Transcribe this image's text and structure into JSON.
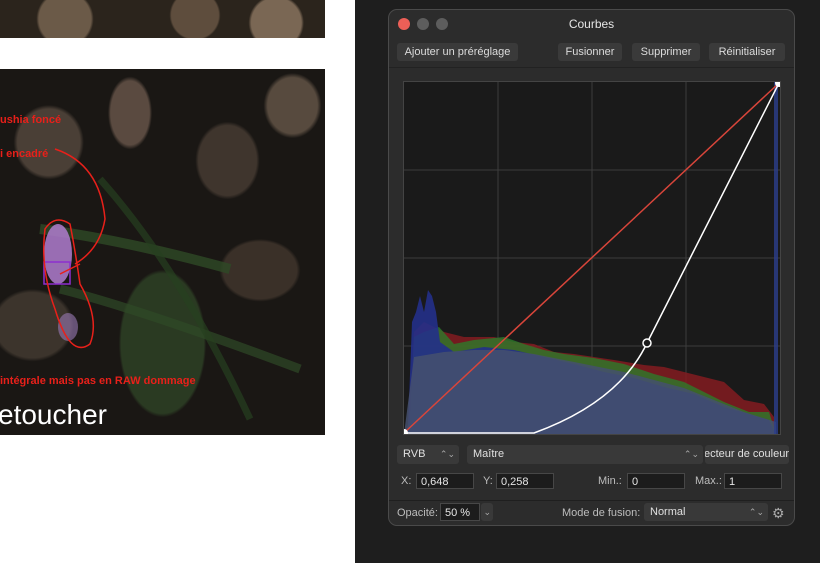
{
  "left": {
    "annotations": [
      "ushia foncé",
      "i encadré",
      "intégrale mais pas en RAW dommage"
    ],
    "heading": "etoucher"
  },
  "panel": {
    "title": "Courbes",
    "buttons": {
      "preset": "Ajouter un préréglage",
      "merge": "Fusionner",
      "delete": "Supprimer",
      "reset": "Réinitialiser"
    },
    "channel": "RVB",
    "mode_select": "Maître",
    "color_picker": "Sélecteur de couleur",
    "x_label": "X:",
    "x_value": "0,648",
    "y_label": "Y:",
    "y_value": "0,258",
    "min_label": "Min.:",
    "min_value": "0",
    "max_label": "Max.:",
    "max_value": "1",
    "opacity_label": "Opacité:",
    "opacity_value": "50 %",
    "blend_label": "Mode de fusion:",
    "blend_value": "Normal",
    "colors": {
      "curve": "#ffffff",
      "diagonal": "#d8453a",
      "close": "#ec5f57"
    }
  }
}
